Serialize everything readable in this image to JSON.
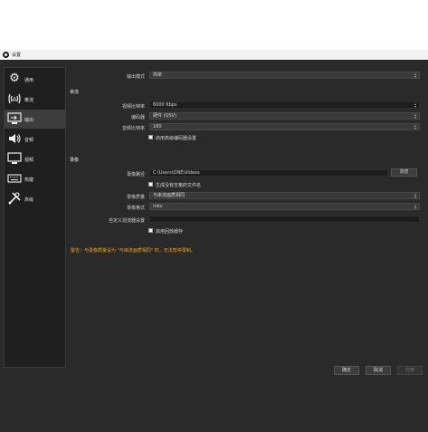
{
  "window": {
    "title": "设置"
  },
  "sidebar": {
    "items": [
      {
        "label": "通用",
        "icon": "gear-icon"
      },
      {
        "label": "推流",
        "icon": "broadcast-icon"
      },
      {
        "label": "输出",
        "icon": "output-icon",
        "active": true
      },
      {
        "label": "音频",
        "icon": "speaker-icon"
      },
      {
        "label": "视频",
        "icon": "monitor-icon"
      },
      {
        "label": "热键",
        "icon": "keyboard-icon"
      },
      {
        "label": "高级",
        "icon": "tools-icon"
      }
    ]
  },
  "output": {
    "mode_label": "输出模式",
    "mode_value": "简单",
    "streaming": {
      "title": "串流",
      "bitrate_label": "视频比特率",
      "bitrate_value": "6000 Kbps",
      "encoder_label": "编码器",
      "encoder_value": "硬件 (QSV)",
      "audio_bitrate_label": "音频比特率",
      "audio_bitrate_value": "160",
      "advanced_encoder_label": "启用高级编码器设置"
    },
    "recording": {
      "title": "录像",
      "path_label": "录像路径",
      "path_value": "C:\\Users\\ONE\\Videos",
      "browse_label": "浏览",
      "no_space_label": "生成没有空格的文件名",
      "quality_label": "录像质量",
      "quality_value": "与串流画质相同",
      "format_label": "录像格式",
      "format_value": "mkv",
      "muxer_label": "自定义混流器设置",
      "muxer_value": "",
      "replay_label": "启用回放缓存",
      "warning": "警告：与录像质量设为 \"与串流画质相同\" 时，无法暂停录制。"
    }
  },
  "buttons": {
    "ok": "确定",
    "cancel": "取消",
    "apply": "应用"
  }
}
